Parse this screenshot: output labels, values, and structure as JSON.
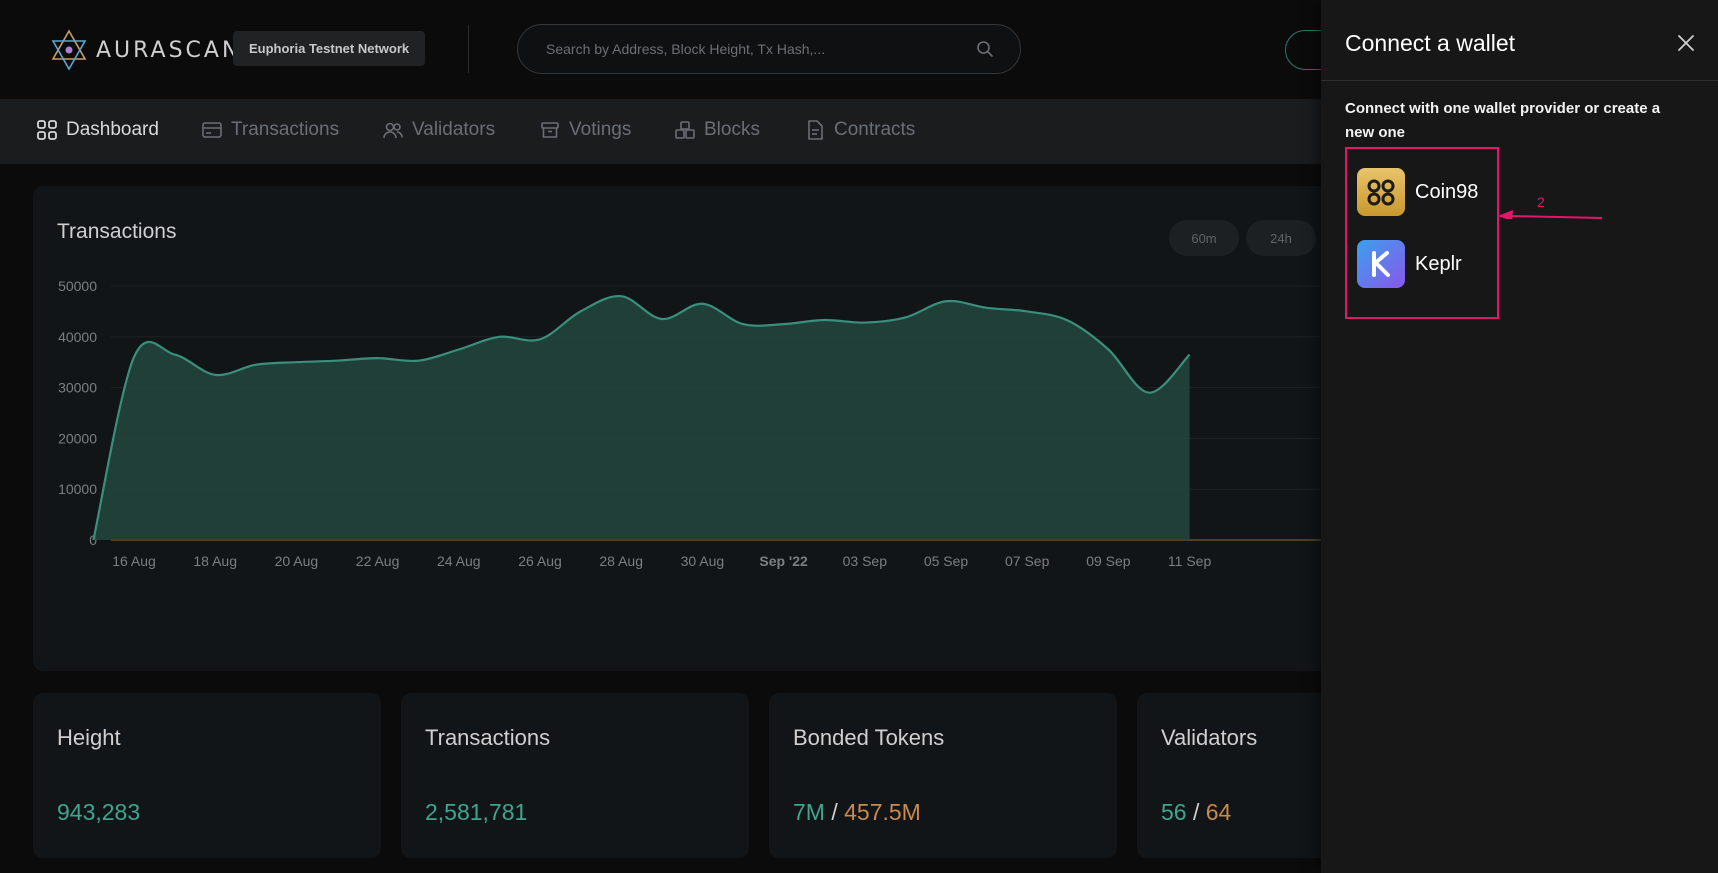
{
  "header": {
    "brand": "AURASCAN",
    "network": "Euphoria Testnet Network",
    "search_placeholder": "Search by Address, Block Height, Tx Hash,..."
  },
  "nav": {
    "items": [
      {
        "label": "Dashboard",
        "icon": "dashboard-icon",
        "active": true
      },
      {
        "label": "Transactions",
        "icon": "card-icon",
        "active": false
      },
      {
        "label": "Validators",
        "icon": "users-icon",
        "active": false
      },
      {
        "label": "Votings",
        "icon": "archive-box-icon",
        "active": false
      },
      {
        "label": "Blocks",
        "icon": "blocks-icon",
        "active": false
      },
      {
        "label": "Contracts",
        "icon": "document-icon",
        "active": false
      }
    ]
  },
  "chart_section": {
    "title": "Transactions",
    "ranges": [
      "60m",
      "24h"
    ]
  },
  "chart_data": {
    "type": "area",
    "title": "Transactions",
    "x_ticks": [
      "16 Aug",
      "18 Aug",
      "20 Aug",
      "22 Aug",
      "24 Aug",
      "26 Aug",
      "28 Aug",
      "30 Aug",
      "Sep '22",
      "03 Sep",
      "05 Sep",
      "07 Sep",
      "09 Sep",
      "11 Sep"
    ],
    "y_ticks": [
      0,
      10000,
      20000,
      30000,
      40000,
      50000
    ],
    "ylim": [
      0,
      50000
    ],
    "grid": true,
    "points": [
      {
        "x": "15 Aug",
        "y": 0
      },
      {
        "x": "16 Aug",
        "y": 36000
      },
      {
        "x": "17 Aug",
        "y": 36500
      },
      {
        "x": "18 Aug",
        "y": 32500
      },
      {
        "x": "19 Aug",
        "y": 34500
      },
      {
        "x": "20 Aug",
        "y": 35000
      },
      {
        "x": "21 Aug",
        "y": 35300
      },
      {
        "x": "22 Aug",
        "y": 35800
      },
      {
        "x": "23 Aug",
        "y": 35300
      },
      {
        "x": "24 Aug",
        "y": 37500
      },
      {
        "x": "25 Aug",
        "y": 40000
      },
      {
        "x": "26 Aug",
        "y": 39500
      },
      {
        "x": "27 Aug",
        "y": 45000
      },
      {
        "x": "28 Aug",
        "y": 48000
      },
      {
        "x": "29 Aug",
        "y": 43500
      },
      {
        "x": "30 Aug",
        "y": 46500
      },
      {
        "x": "31 Aug",
        "y": 42500
      },
      {
        "x": "01 Sep",
        "y": 42500
      },
      {
        "x": "02 Sep",
        "y": 43300
      },
      {
        "x": "03 Sep",
        "y": 42800
      },
      {
        "x": "04 Sep",
        "y": 43800
      },
      {
        "x": "05 Sep",
        "y": 47000
      },
      {
        "x": "06 Sep",
        "y": 45700
      },
      {
        "x": "07 Sep",
        "y": 45000
      },
      {
        "x": "08 Sep",
        "y": 43200
      },
      {
        "x": "09 Sep",
        "y": 37500
      },
      {
        "x": "10 Sep",
        "y": 29000
      },
      {
        "x": "11 Sep",
        "y": 36500
      }
    ],
    "line_color": "#3a8f7c",
    "fill_color": "#24463f"
  },
  "stats": [
    {
      "label": "Height",
      "value": "943,283"
    },
    {
      "label": "Transactions",
      "value": "2,581,781"
    },
    {
      "label": "Bonded Tokens",
      "value_a": "7M",
      "sep": " / ",
      "value_b": "457.5M"
    },
    {
      "label": "Validators",
      "value_a": "56",
      "sep": " / ",
      "value_b": "64"
    }
  ],
  "drawer": {
    "title": "Connect a wallet",
    "description": "Connect with one wallet provider or create a new one",
    "wallets": [
      {
        "name": "Coin98",
        "icon": "coin98-icon"
      },
      {
        "name": "Keplr",
        "icon": "keplr-icon"
      }
    ],
    "annotation": "2"
  },
  "colors": {
    "accent_green": "#3fa58f",
    "accent_orange": "#c98a4a",
    "annotation": "#e3166c"
  }
}
